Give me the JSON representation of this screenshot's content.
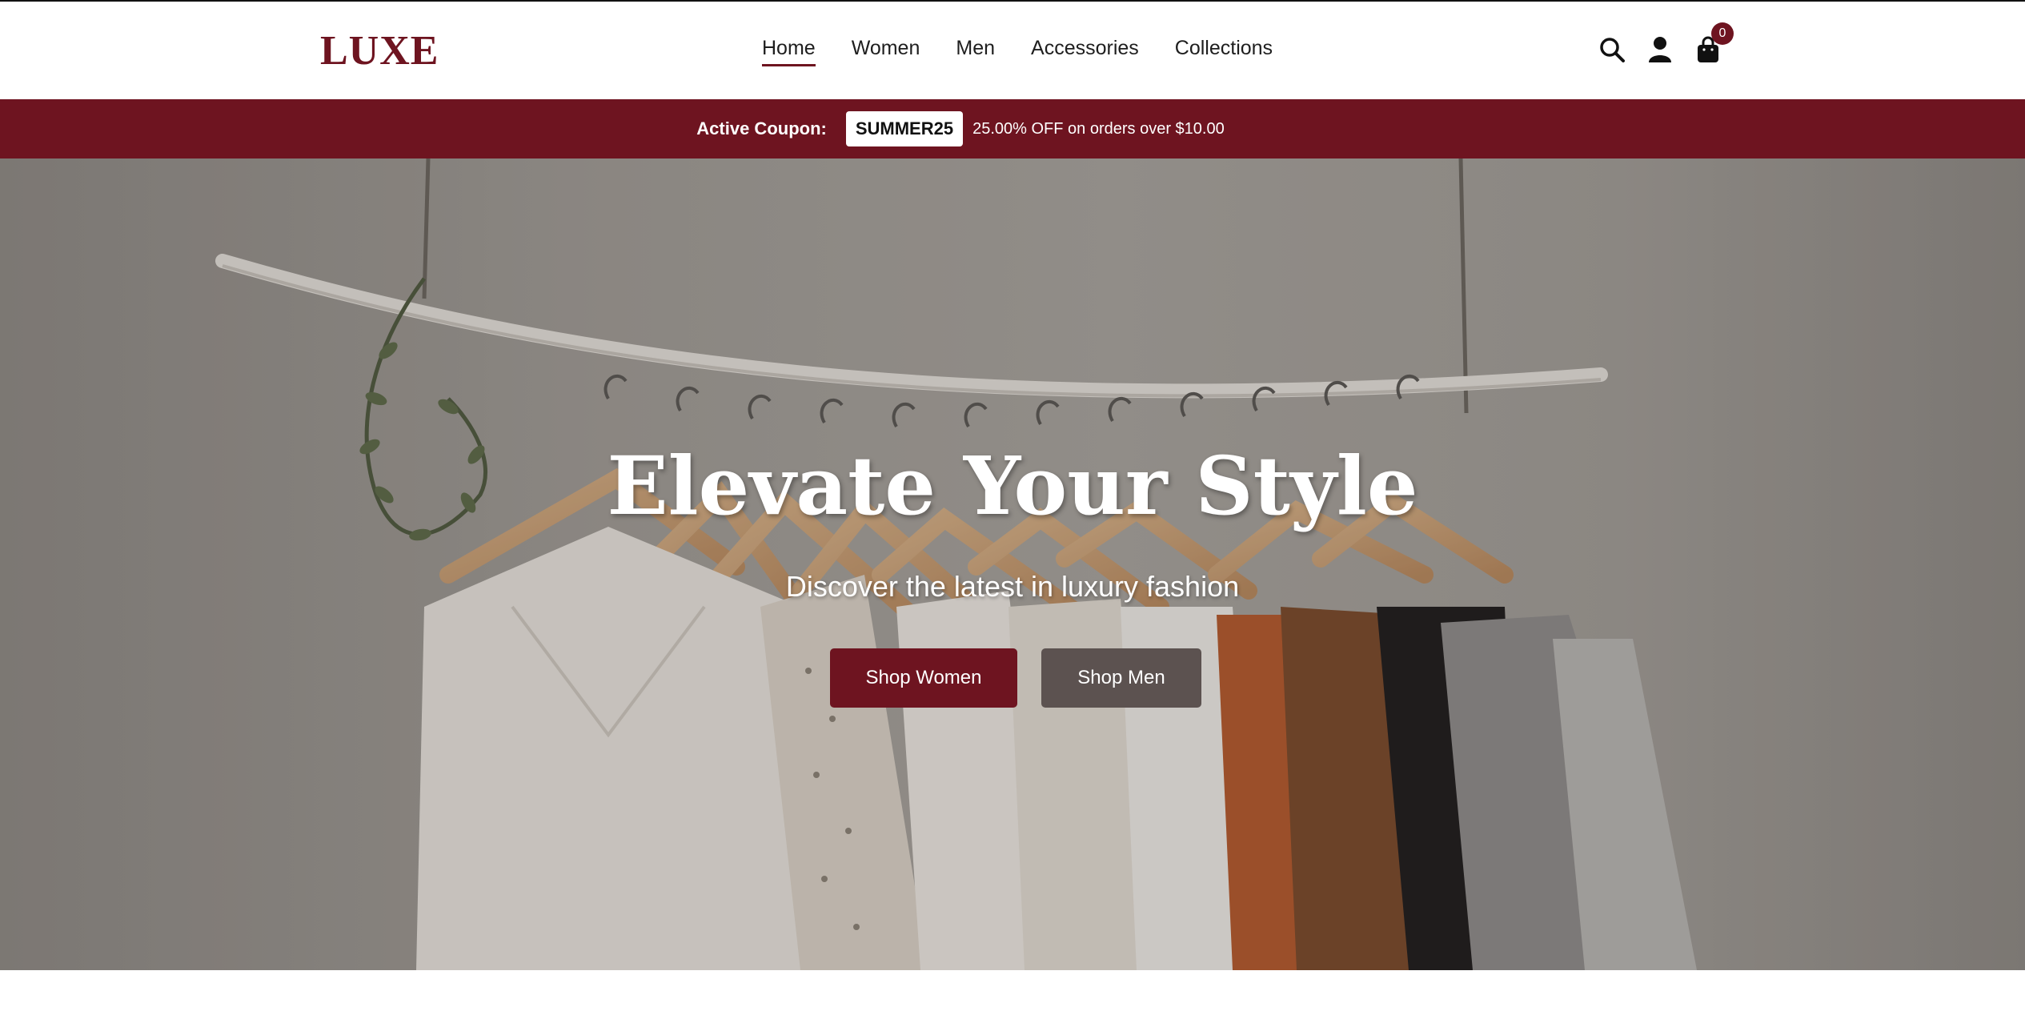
{
  "header": {
    "logo": "LUXE",
    "nav": [
      {
        "label": "Home",
        "active": true
      },
      {
        "label": "Women",
        "active": false
      },
      {
        "label": "Men",
        "active": false
      },
      {
        "label": "Accessories",
        "active": false
      },
      {
        "label": "Collections",
        "active": false
      }
    ],
    "icons": [
      "search-icon",
      "user-icon",
      "shopping-bag-icon"
    ],
    "cart_count": "0"
  },
  "coupon": {
    "label": "Active Coupon:",
    "code": "SUMMER25",
    "description": "25.00% OFF on orders over $10.00"
  },
  "hero": {
    "title": "Elevate Your Style",
    "subtitle": "Discover the latest in luxury fashion",
    "buttons": {
      "shop_women": "Shop Women",
      "shop_men": "Shop Men"
    }
  },
  "colors": {
    "brand": "#6e1420",
    "secondary_button": "#5c5250",
    "text": "#1e1e1e"
  }
}
